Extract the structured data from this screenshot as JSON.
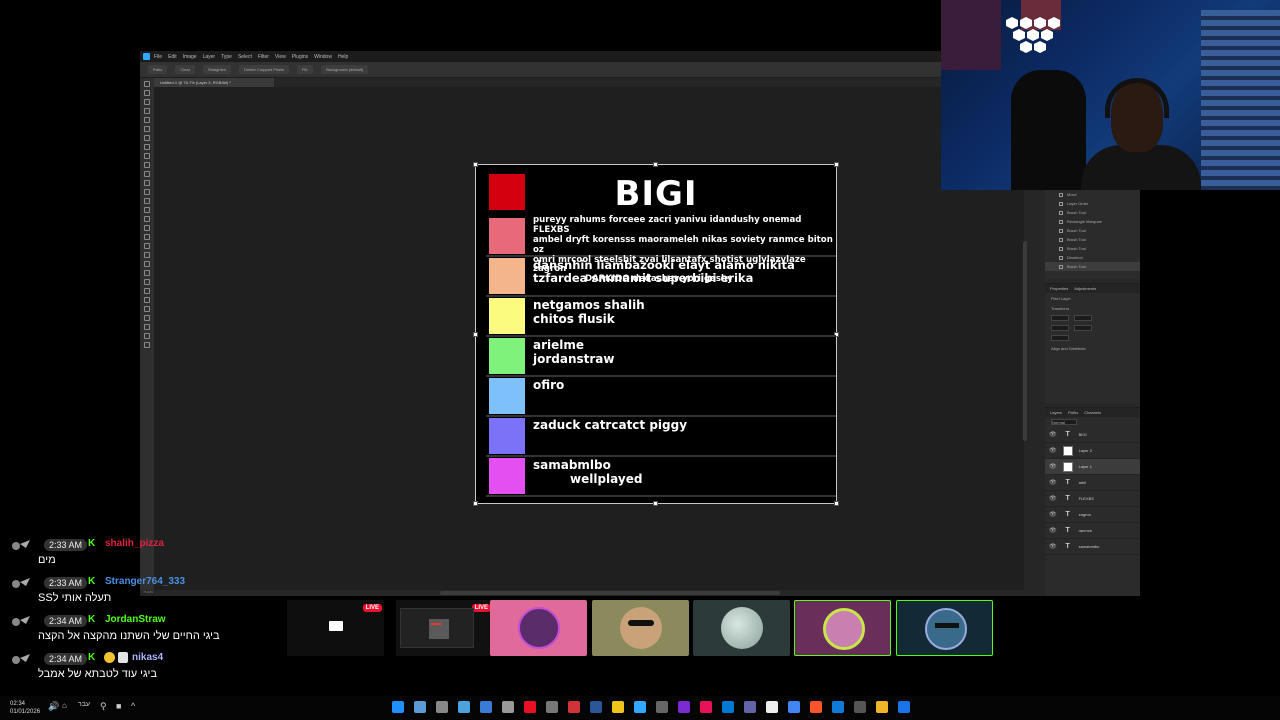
{
  "photoshop": {
    "menu": [
      "File",
      "Edit",
      "Image",
      "Layer",
      "Type",
      "Select",
      "Filter",
      "View",
      "Plugins",
      "Window",
      "Help"
    ],
    "options": [
      "Ratio",
      "Clear",
      "Straighten",
      "Delete Cropped Pixels",
      "Fill:",
      "Background (default)"
    ],
    "doc_tab": "Untitled-1 @ 76.7% (Layer 3, RGB/8#) *",
    "status": "76.62%",
    "history_items": [
      "Move",
      "Layer Order",
      "Brush Tool",
      "Rectangle Marquee",
      "Brush Tool",
      "Brush Tool",
      "Brush Tool",
      "Deselect",
      "Brush Tool"
    ],
    "properties_tabs": [
      "Properties",
      "Adjustments"
    ],
    "properties_label": "Pixel Layer",
    "transform_label": "Transform",
    "align_label": "Align and Distribute",
    "layers_tabs": [
      "Layers",
      "Paths",
      "Channels"
    ],
    "layers_mode": "Normal",
    "layers": [
      {
        "type": "T",
        "name": "BIGI"
      },
      {
        "type": "img",
        "name": "Layer 2"
      },
      {
        "type": "img",
        "name": "Layer 1",
        "selected": true
      },
      {
        "type": "T",
        "name": "ariel"
      },
      {
        "type": "T",
        "name": "FLEXBS"
      },
      {
        "type": "T",
        "name": "zagron"
      },
      {
        "type": "T",
        "name": "ranmce"
      },
      {
        "type": "T",
        "name": "samabmlbo"
      }
    ]
  },
  "tierlist": {
    "title": "BIGI",
    "tiers": [
      {
        "color": "#d40010",
        "lines": []
      },
      {
        "color": "#e86a7a",
        "lines": [
          "pureyy rahums forceee zacri yanivu idandushy onemad FLEXBS",
          "ambel dryft korensss maorameleh nikas soviety ranmce biton oz",
          "omri mrcool steelshit zvai lilsantafx shotist uglylazylaze zagron",
          "DARKIDO dedashev yori gashy"
        ]
      },
      {
        "color": "#f4b58a",
        "lines": [
          "dansnhin liambazooki elayt alamo nikita",
          "tzfardea smmamit superbibi erika"
        ]
      },
      {
        "color": "#fbfb7f",
        "lines": [
          "netgamos shalih",
          "chitos flusik"
        ]
      },
      {
        "color": "#7ef27a",
        "lines": [
          "arielme",
          "jordanstraw"
        ]
      },
      {
        "color": "#7ec0fb",
        "lines": [
          "ofiro"
        ]
      },
      {
        "color": "#7c72f7",
        "lines": [
          "zaduck catrcatct piggy"
        ]
      },
      {
        "color": "#e34ff0",
        "lines": [
          "samabmlbo",
          "wellplayed"
        ]
      }
    ]
  },
  "chat": [
    {
      "time": "2:33 AM",
      "badge": "K",
      "user": "shalih_pizza",
      "user_color": "#e0233f",
      "text": "מים"
    },
    {
      "time": "2:33 AM",
      "badge": "K",
      "user": "Stranger764_333",
      "user_color": "#4a90e2",
      "text": "תעלה אותי לSS"
    },
    {
      "time": "2:34 AM",
      "badge": "K",
      "user": "JordanStraw",
      "user_color": "#53fc18",
      "text": "ביגי החיים שלי השתנו מהקצה אל הקצה"
    },
    {
      "time": "2:34 AM",
      "badge": "K",
      "user": "nikas4",
      "user_color": "#aab4ff",
      "text": "ביגי עוד לטבתא של אמבל"
    }
  ],
  "streams": {
    "live_label": "LIVE"
  },
  "taskbar": {
    "time": "02:34",
    "date": "01/01/2026",
    "lang": "עבר"
  },
  "colors": {
    "kick_green": "#53fc18",
    "ps_blue": "#31a8ff"
  }
}
